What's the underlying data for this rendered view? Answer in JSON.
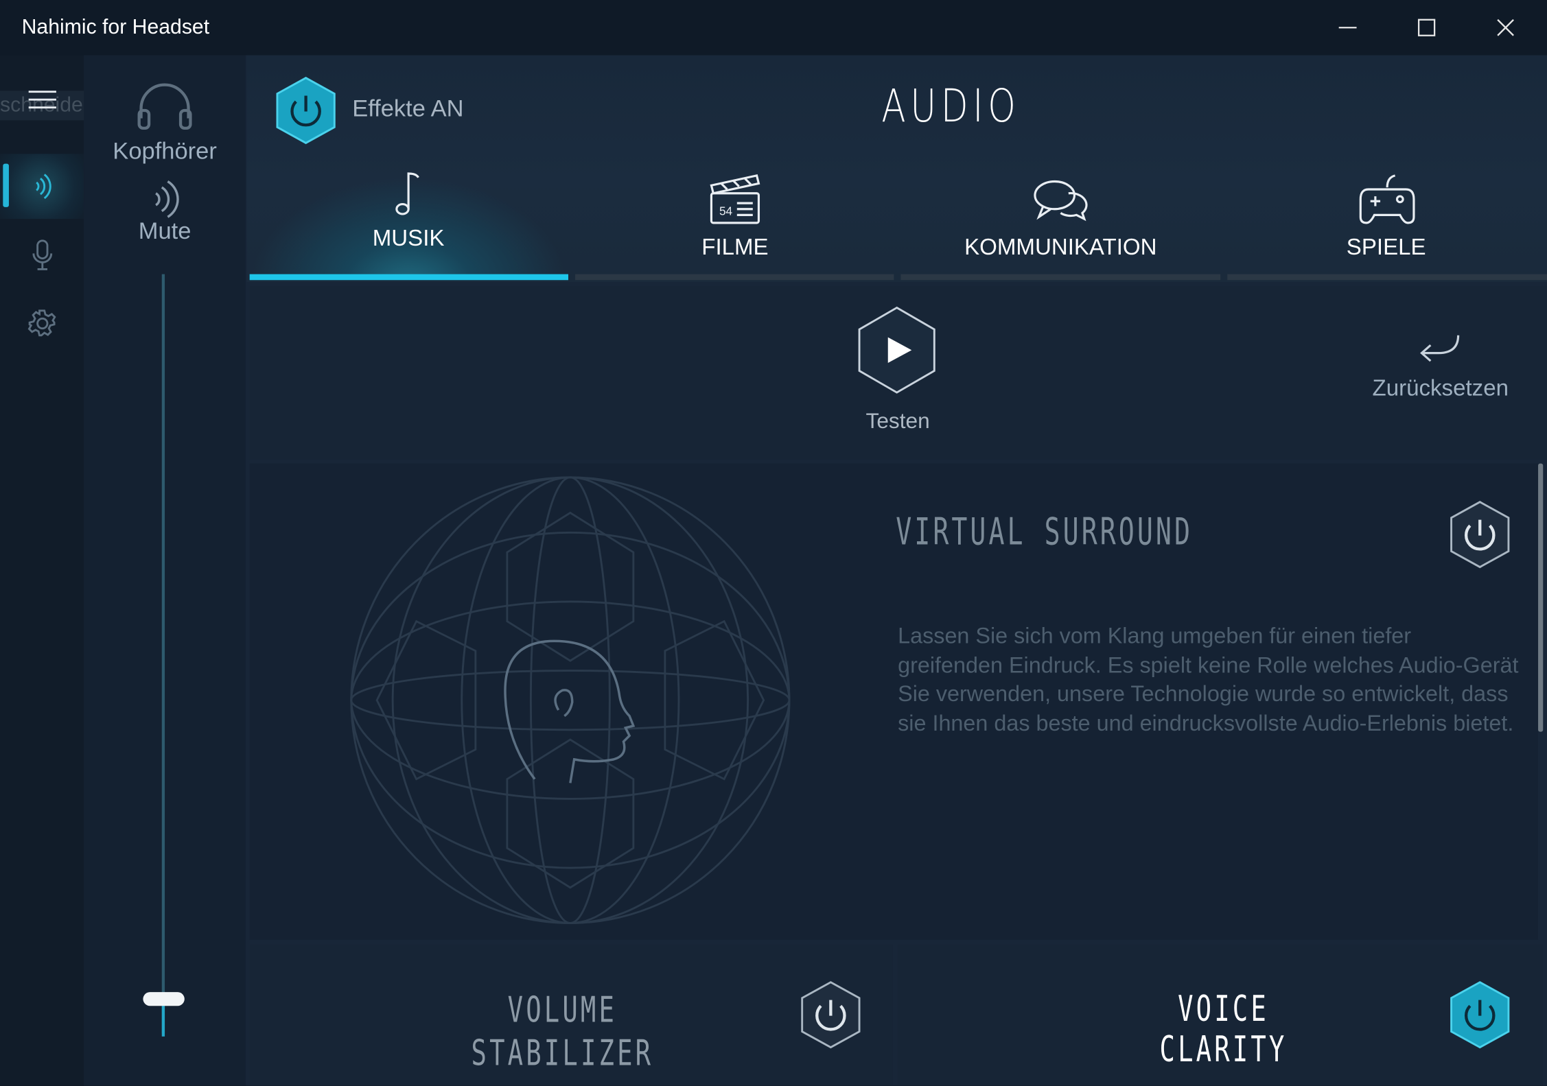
{
  "window": {
    "title": "Nahimic for Headset"
  },
  "rail": {
    "ghost_text": "schneiden",
    "items": [
      {
        "icon": "menu-icon"
      },
      {
        "icon": "speaker-waves-icon",
        "active": true
      },
      {
        "icon": "microphone-icon"
      },
      {
        "icon": "gear-icon"
      }
    ]
  },
  "device": {
    "name": "Kopfhörer",
    "mute_label": "Mute",
    "volume_level": 0.05
  },
  "header": {
    "effects_label": "Effekte AN",
    "title": "AUDIO"
  },
  "tabs": [
    {
      "label": "MUSIK",
      "icon": "music-note-icon",
      "active": true
    },
    {
      "label": "FILME",
      "icon": "clapperboard-icon",
      "active": false
    },
    {
      "label": "KOMMUNIKATION",
      "icon": "chat-bubbles-icon",
      "active": false
    },
    {
      "label": "SPIELE",
      "icon": "gamepad-icon",
      "active": false
    }
  ],
  "actions": {
    "test_label": "Testen",
    "reset_label": "Zurücksetzen"
  },
  "effects": {
    "virtual_surround": {
      "title": "VIRTUAL SURROUND",
      "description": "Lassen Sie sich vom Klang umgeben für einen tiefer greifenden Eindruck. Es spielt keine Rolle welches Audio-Gerät Sie verwenden, unsere Technologie wurde so entwickelt, dass sie Ihnen das beste und eindrucksvollste Audio-Erlebnis bietet.",
      "enabled": false
    },
    "volume_stabilizer": {
      "title_line1": "VOLUME",
      "title_line2": "STABILIZER",
      "enabled": false
    },
    "voice_clarity": {
      "title": "VOICE CLARITY",
      "enabled": true
    }
  },
  "colors": {
    "accent": "#1ec6ea",
    "background": "#182638",
    "titlebar": "#0f1a27"
  }
}
